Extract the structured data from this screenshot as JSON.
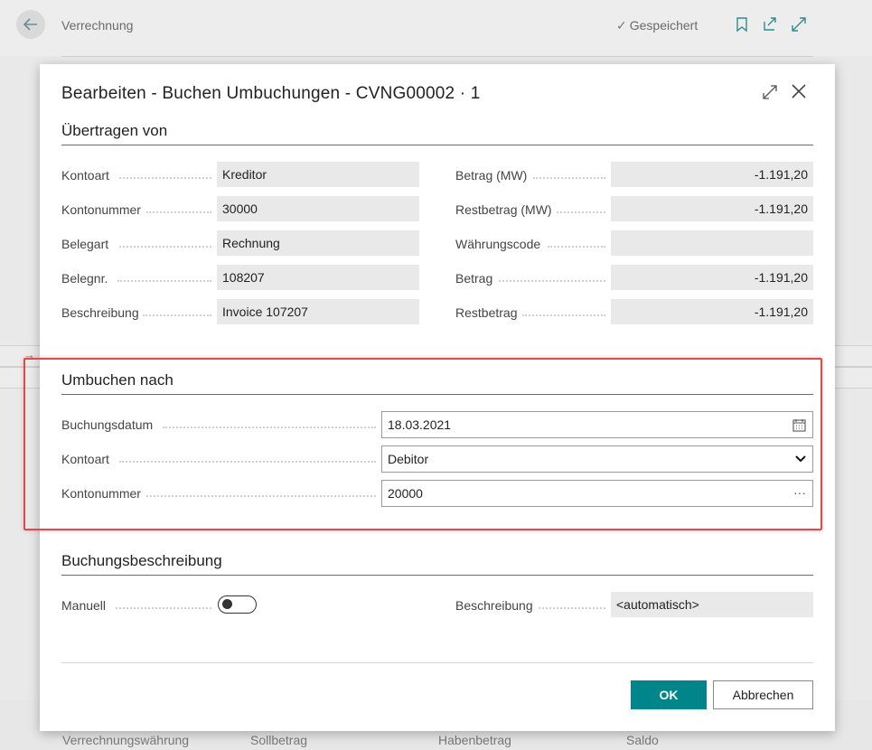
{
  "background": {
    "title": "Verrechnung",
    "saved_label": "Gespeichert",
    "columns": [
      "Verrechnungswährung",
      "Sollbetrag",
      "Habenbetrag",
      "Saldo"
    ]
  },
  "dialog": {
    "title": "Bearbeiten - Buchen Umbuchungen - CVNG00002 · 1",
    "section_from": {
      "title": "Übertragen von",
      "left_fields": [
        {
          "label": "Kontoart",
          "value": "Kreditor"
        },
        {
          "label": "Kontonummer",
          "value": "30000"
        },
        {
          "label": "Belegart",
          "value": "Rechnung"
        },
        {
          "label": "Belegnr.",
          "value": "108207"
        },
        {
          "label": "Beschreibung",
          "value": "Invoice 107207"
        }
      ],
      "right_fields": [
        {
          "label": "Betrag (MW)",
          "value": "-1.191,20"
        },
        {
          "label": "Restbetrag (MW)",
          "value": "-1.191,20"
        },
        {
          "label": "Währungscode",
          "value": ""
        },
        {
          "label": "Betrag",
          "value": "-1.191,20"
        },
        {
          "label": "Restbetrag",
          "value": "-1.191,20"
        }
      ]
    },
    "section_to": {
      "title": "Umbuchen nach",
      "posting_date": {
        "label": "Buchungsdatum",
        "value": "18.03.2021"
      },
      "account_type": {
        "label": "Kontoart",
        "value": "Debitor",
        "options": [
          "Debitor"
        ]
      },
      "account_no": {
        "label": "Kontonummer",
        "value": "20000",
        "trail": "···"
      }
    },
    "section_desc": {
      "title": "Buchungsbeschreibung",
      "manual": {
        "label": "Manuell",
        "on": false
      },
      "description": {
        "label": "Beschreibung",
        "value": "<automatisch>"
      }
    },
    "buttons": {
      "ok": "OK",
      "cancel": "Abbrechen"
    }
  }
}
